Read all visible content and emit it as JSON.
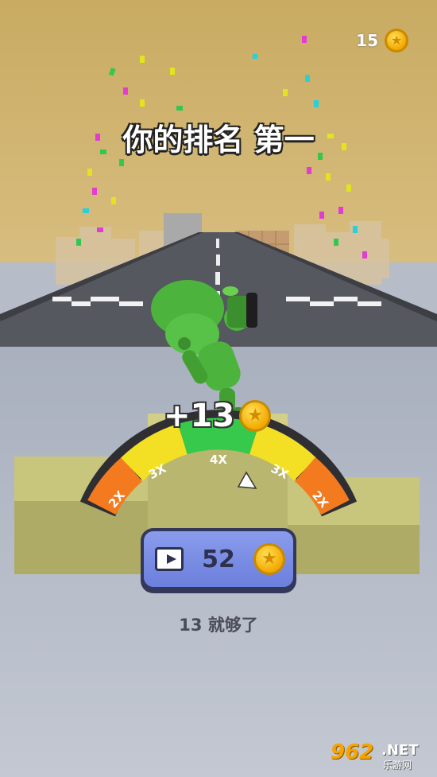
{
  "hud": {
    "coin_count": "15",
    "coin_icon": "gold-star-coin-icon"
  },
  "result": {
    "title": "你的排名 第一"
  },
  "reward": {
    "plus_text": "+13"
  },
  "multiplier_meter": {
    "segments": [
      "2X",
      "3X",
      "4X",
      "3X",
      "2X"
    ],
    "segment_colors": [
      "#f47a1f",
      "#f3e025",
      "#37c94b",
      "#f3e025",
      "#f47a1f"
    ]
  },
  "ad_reward_button": {
    "icon": "video-play-icon",
    "value": "52"
  },
  "skip_link": {
    "label": "13 就够了"
  },
  "watermark": {
    "main": "962",
    "net": ".NET",
    "sub": "乐游网"
  },
  "colors": {
    "accent_button": "#7b8de3",
    "button_border": "#33385a",
    "coin": "#f6b800"
  }
}
